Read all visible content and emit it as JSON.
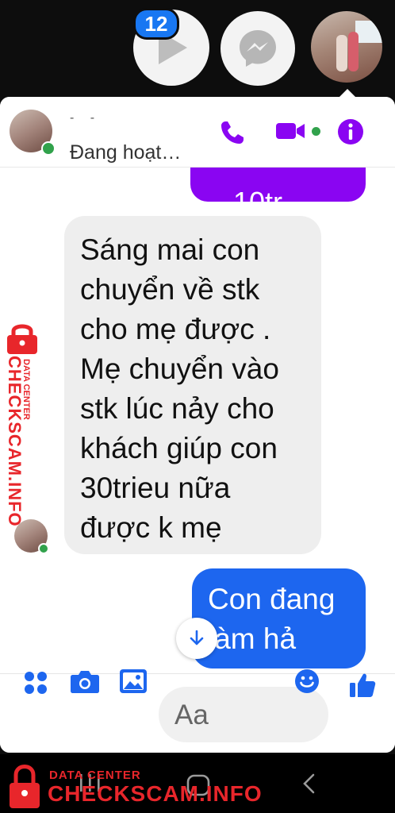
{
  "chat_heads": {
    "badge_count": "12",
    "items": [
      "play-icon",
      "messenger-icon",
      "contact-avatar"
    ]
  },
  "header": {
    "name": "- -",
    "status": "Đang hoạt…"
  },
  "messages": {
    "outgoing_partial": "10tr",
    "incoming": "Sáng mai con\nchuyển về stk\ncho mẹ được .\nMẹ chuyển vào\nstk lúc nảy cho\nkhách giúp con\n30trieu nữa\nđược k mẹ",
    "outgoing": "Con đang\nlàm hả"
  },
  "composer": {
    "placeholder": "Aa"
  },
  "watermark": {
    "small": "DATA CENTER",
    "big": "CHECKSCAM.INFO"
  },
  "colors": {
    "messenger_blue": "#1d66ef",
    "messenger_purple": "#8a05f2",
    "online_green": "#31a24c",
    "watermark_red": "#e8262b"
  }
}
